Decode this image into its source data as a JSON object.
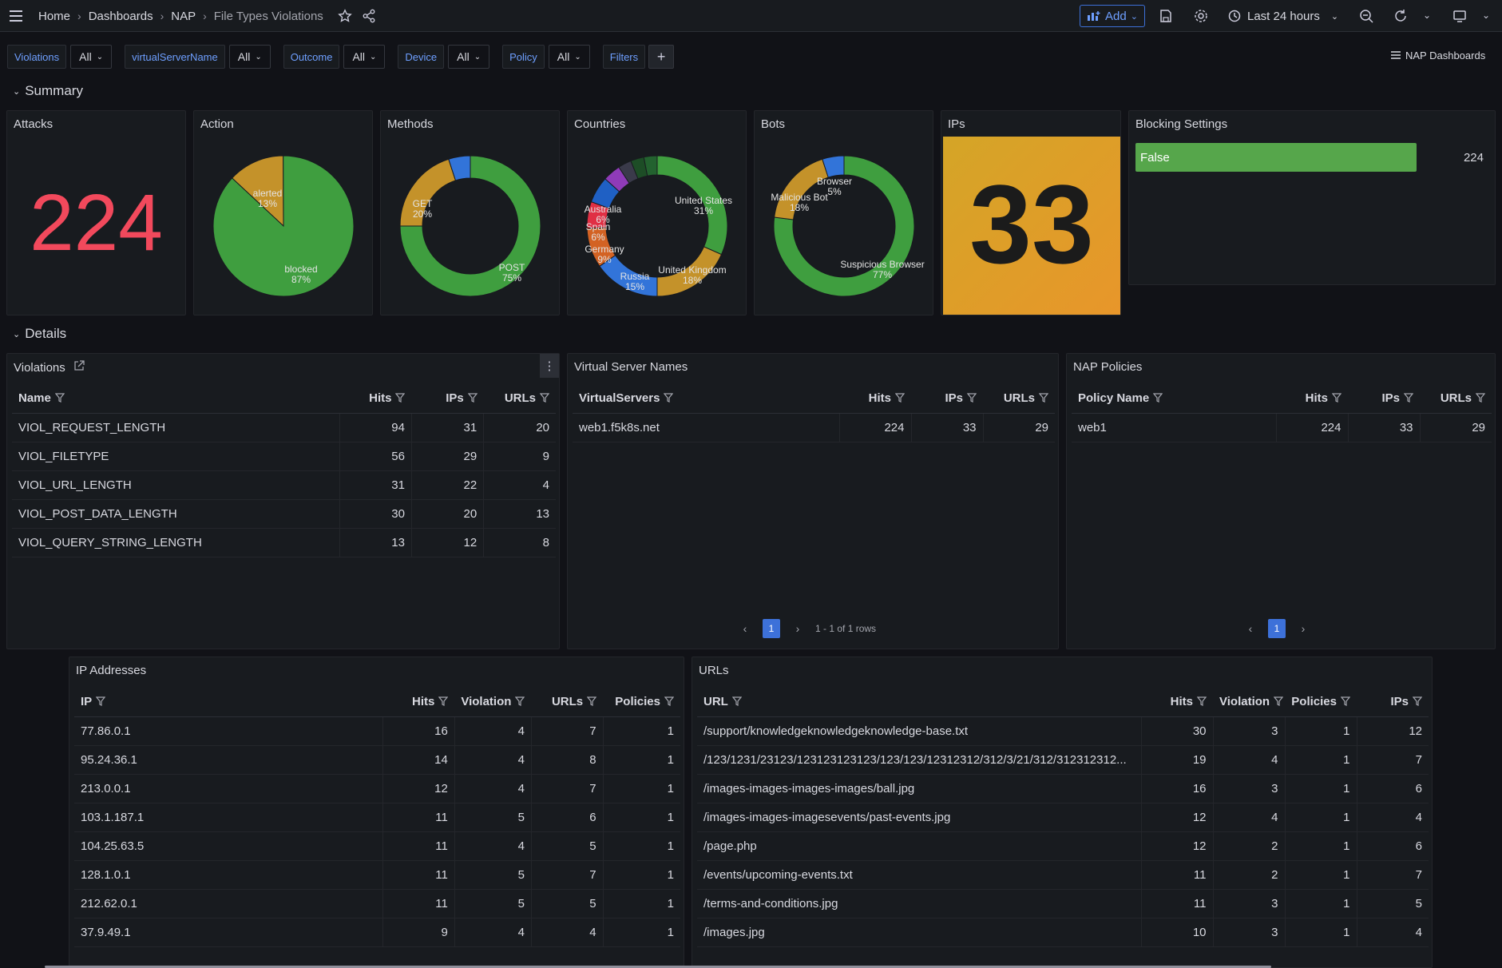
{
  "breadcrumb": [
    "Home",
    "Dashboards",
    "NAP",
    "File Types Violations"
  ],
  "toolbar": {
    "add_label": "Add",
    "time_range": "Last 24 hours"
  },
  "variables": [
    {
      "label": "Violations",
      "value": "All"
    },
    {
      "label": "virtualServerName",
      "value": "All"
    },
    {
      "label": "Outcome",
      "value": "All"
    },
    {
      "label": "Device",
      "value": "All"
    },
    {
      "label": "Policy",
      "value": "All"
    }
  ],
  "filters_label": "Filters",
  "dashboards_link": "NAP Dashboards",
  "rows": {
    "summary": "Summary",
    "details": "Details"
  },
  "summary": {
    "attacks": {
      "title": "Attacks",
      "value": "224",
      "color": "#f2495c"
    },
    "action": {
      "title": "Action",
      "slices": [
        {
          "name": "alerted",
          "pct": "13%",
          "value": 13,
          "color": "#c4922a"
        },
        {
          "name": "blocked",
          "pct": "87%",
          "value": 87,
          "color": "#3f9e3f"
        }
      ]
    },
    "methods": {
      "title": "Methods",
      "slices": [
        {
          "name": "POST",
          "pct": "75%",
          "value": 75,
          "color": "#3f9e3f"
        },
        {
          "name": "GET",
          "pct": "20%",
          "value": 20,
          "color": "#c4922a"
        },
        {
          "name": "",
          "pct": "",
          "value": 5,
          "color": "#3274d9"
        }
      ]
    },
    "countries": {
      "title": "Countries",
      "slices": [
        {
          "name": "United States",
          "pct": "31%",
          "value": 31,
          "color": "#3f9e3f"
        },
        {
          "name": "United Kingdom",
          "pct": "18%",
          "value": 18,
          "color": "#c4922a"
        },
        {
          "name": "Russia",
          "pct": "15%",
          "value": 15,
          "color": "#3274d9"
        },
        {
          "name": "Germany",
          "pct": "9%",
          "value": 9,
          "color": "#d36223"
        },
        {
          "name": "Spain",
          "pct": "6%",
          "value": 6,
          "color": "#e02f44"
        },
        {
          "name": "Australia",
          "pct": "6%",
          "value": 6,
          "color": "#1f60c4"
        },
        {
          "name": "",
          "pct": "",
          "value": 4,
          "color": "#8f3bb8"
        },
        {
          "name": "",
          "pct": "",
          "value": 3,
          "color": "#3a3a4a"
        },
        {
          "name": "",
          "pct": "",
          "value": 3,
          "color": "#1d4d26"
        },
        {
          "name": "",
          "pct": "",
          "value": 3,
          "color": "#23622f"
        }
      ]
    },
    "bots": {
      "title": "Bots",
      "slices": [
        {
          "name": "Suspicious Browser",
          "pct": "77%",
          "value": 77,
          "color": "#3f9e3f"
        },
        {
          "name": "Malicious Bot",
          "pct": "18%",
          "value": 18,
          "color": "#c4922a"
        },
        {
          "name": "Browser",
          "pct": "5%",
          "value": 5,
          "color": "#3274d9"
        }
      ]
    },
    "ips": {
      "title": "IPs",
      "value": "33"
    },
    "blocking": {
      "title": "Blocking Settings",
      "bar_label": "False",
      "bar_value": "224",
      "bar_color": "#56a64b"
    }
  },
  "violations": {
    "title": "Violations",
    "columns": [
      "Name",
      "Hits",
      "IPs",
      "URLs"
    ],
    "rows": [
      [
        "VIOL_REQUEST_LENGTH",
        "94",
        "31",
        "20"
      ],
      [
        "VIOL_FILETYPE",
        "56",
        "29",
        "9"
      ],
      [
        "VIOL_URL_LENGTH",
        "31",
        "22",
        "4"
      ],
      [
        "VIOL_POST_DATA_LENGTH",
        "30",
        "20",
        "13"
      ],
      [
        "VIOL_QUERY_STRING_LENGTH",
        "13",
        "12",
        "8"
      ]
    ]
  },
  "virtual_servers": {
    "title": "Virtual Server Names",
    "columns": [
      "VirtualServers",
      "Hits",
      "IPs",
      "URLs"
    ],
    "rows": [
      [
        "web1.f5k8s.net",
        "224",
        "33",
        "29"
      ]
    ],
    "page": "1",
    "row_info": "1 - 1 of 1 rows"
  },
  "nap_policies": {
    "title": "NAP Policies",
    "columns": [
      "Policy Name",
      "Hits",
      "IPs",
      "URLs"
    ],
    "rows": [
      [
        "web1",
        "224",
        "33",
        "29"
      ]
    ],
    "page": "1"
  },
  "ip_addresses": {
    "title": "IP Addresses",
    "columns": [
      "IP",
      "Hits",
      "Violation",
      "URLs",
      "Policies"
    ],
    "rows": [
      [
        "77.86.0.1",
        "16",
        "4",
        "7",
        "1"
      ],
      [
        "95.24.36.1",
        "14",
        "4",
        "8",
        "1"
      ],
      [
        "213.0.0.1",
        "12",
        "4",
        "7",
        "1"
      ],
      [
        "103.1.187.1",
        "11",
        "5",
        "6",
        "1"
      ],
      [
        "104.25.63.5",
        "11",
        "4",
        "5",
        "1"
      ],
      [
        "128.1.0.1",
        "11",
        "5",
        "7",
        "1"
      ],
      [
        "212.62.0.1",
        "11",
        "5",
        "5",
        "1"
      ],
      [
        "37.9.49.1",
        "9",
        "4",
        "4",
        "1"
      ]
    ]
  },
  "urls": {
    "title": "URLs",
    "columns": [
      "URL",
      "Hits",
      "Violation",
      "Policies",
      "IPs"
    ],
    "rows": [
      [
        "/support/knowledgeknowledgeknowledge-base.txt",
        "30",
        "3",
        "1",
        "12"
      ],
      [
        "/123/1231/23123/123123123123/123/123/12312312/312/3/21/312/312312312...",
        "19",
        "4",
        "1",
        "7"
      ],
      [
        "/images-images-images-images/ball.jpg",
        "16",
        "3",
        "1",
        "6"
      ],
      [
        "/images-images-imagesevents/past-events.jpg",
        "12",
        "4",
        "1",
        "4"
      ],
      [
        "/page.php",
        "12",
        "2",
        "1",
        "6"
      ],
      [
        "/events/upcoming-events.txt",
        "11",
        "2",
        "1",
        "7"
      ],
      [
        "/terms-and-conditions.jpg",
        "11",
        "3",
        "1",
        "5"
      ],
      [
        "/images.jpg",
        "10",
        "3",
        "1",
        "4"
      ]
    ]
  }
}
